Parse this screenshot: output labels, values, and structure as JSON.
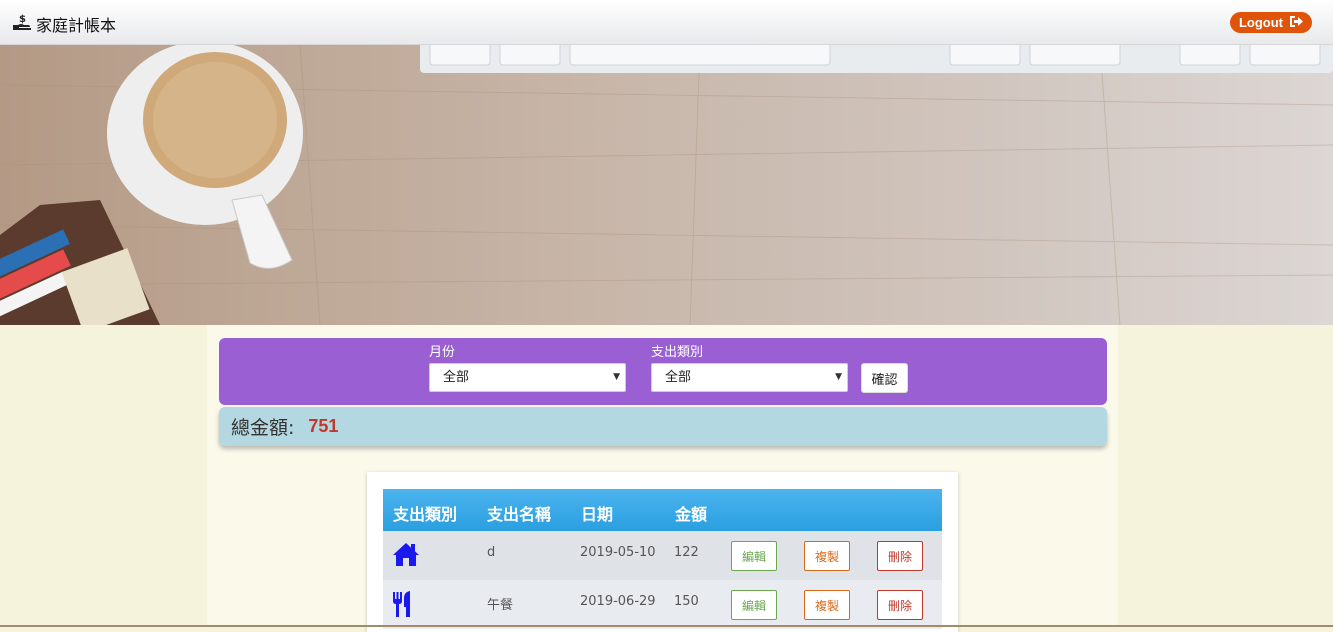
{
  "header": {
    "brand_icon": "hand-holding-dollar-icon",
    "brand_title": "家庭計帳本",
    "logout_label": "Logout",
    "logout_icon": "sign-out-icon",
    "logout_color": "#e0540a"
  },
  "filters": {
    "month_label": "月份",
    "month_value": "全部",
    "category_label": "支出類別",
    "category_value": "全部",
    "confirm_label": "確認",
    "bar_color": "#9a5fd3"
  },
  "total": {
    "label": "總金額:",
    "value": "751"
  },
  "table": {
    "columns": [
      "支出類別",
      "支出名稱",
      "日期",
      "金額"
    ],
    "rows": [
      {
        "category_icon": "home-icon",
        "name": "d",
        "date": "2019-05-10",
        "amount": "122",
        "edit": "編輯",
        "copy": "複製",
        "delete": "刪除"
      },
      {
        "category_icon": "utensils-icon",
        "name": "午餐",
        "date": "2019-06-29",
        "amount": "150",
        "edit": "編輯",
        "copy": "複製",
        "delete": "刪除"
      }
    ],
    "header_color": "#2a9fe0",
    "row_colors": [
      "#dfe3e8",
      "#e8ecf0"
    ]
  }
}
